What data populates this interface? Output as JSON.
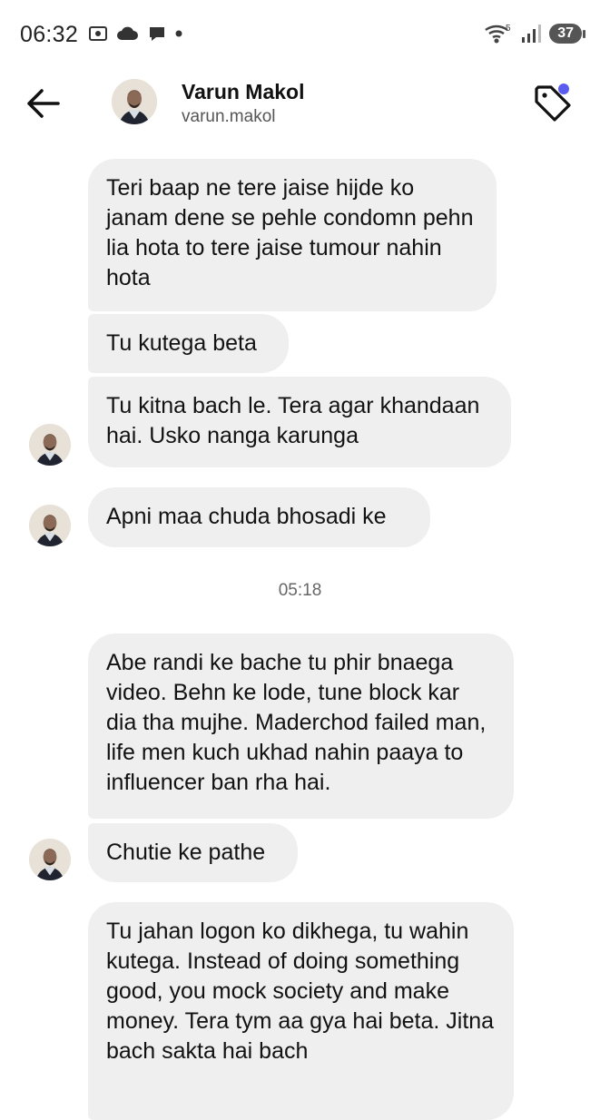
{
  "status_bar": {
    "time": "06:32",
    "network_label": "5",
    "battery": "37"
  },
  "header": {
    "name": "Varun Makol",
    "username": "varun.makol",
    "icons": [
      "back-arrow-icon",
      "tag-icon"
    ],
    "notification_dot_color": "#5b5bf0"
  },
  "messages": [
    {
      "text": "Teri baap ne tere jaise hijde ko janam dene se pehle condomn pehn lia hota to tere jaise tumour nahin hota"
    },
    {
      "text": "Tu kutega beta"
    },
    {
      "text": "Tu kitna bach le. Tera agar khandaan hai. Usko nanga karunga"
    },
    {
      "text": "Apni maa chuda bhosadi ke"
    },
    {
      "text": "Abe randi ke bache tu phir bnaega video. Behn ke lode, tune block kar dia tha mujhe. Maderchod failed man, life men kuch ukhad nahin paaya to influencer ban rha hai."
    },
    {
      "text": "Chutie ke pathe"
    },
    {
      "text": "Tu jahan logon ko dikhega, tu wahin kutega. Instead of doing something good, you mock society and make money. Tera tym aa gya hai beta. Jitna bach sakta hai bach"
    }
  ],
  "timestamp": "05:18",
  "colors": {
    "bubble_bg": "#efefef",
    "text": "#121212",
    "secondary_text": "#666666"
  }
}
